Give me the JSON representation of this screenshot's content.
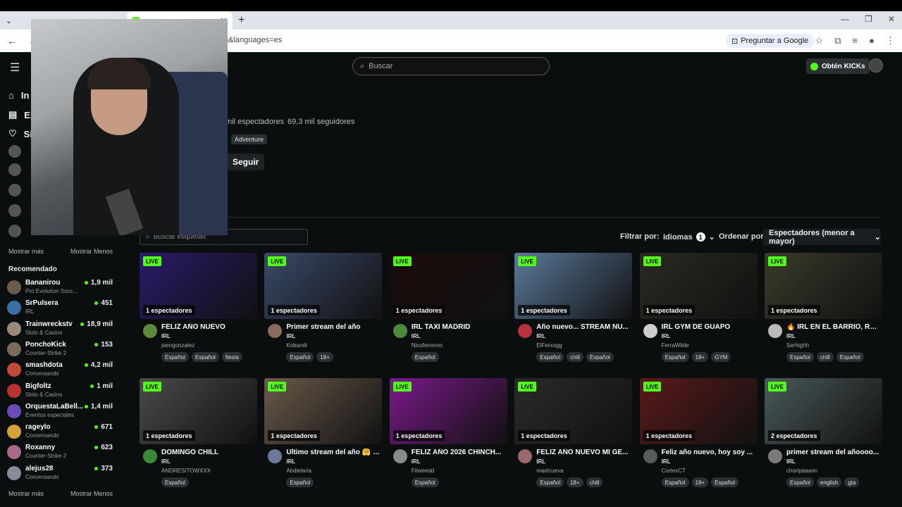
{
  "browser": {
    "url_fragment": "n&languages=es",
    "ask_google": "Preguntar a Google"
  },
  "header": {
    "search_placeholder": "Buscar",
    "kicks_label": "Obtén KICKs"
  },
  "sidebar": {
    "nav_inicio": "In",
    "nav_explorar": "Ex",
    "nav_siguiendo": "Si",
    "show_more_1": "Mostrar más",
    "show_less_1": "Mostrar Menos",
    "recommended_title": "Recomendado",
    "show_more_2": "Mostrar más",
    "show_less_2": "Mostrar Menos",
    "recommended": [
      {
        "name": "Bananirou",
        "category": "Pro Evolution Socc...",
        "viewers": "1,9 mil",
        "color": "#6b5a4a"
      },
      {
        "name": "SrPulsera",
        "category": "IRL",
        "viewers": "451",
        "color": "#3b6ea5"
      },
      {
        "name": "Trainwreckstv",
        "category": "Slots & Casino",
        "viewers": "18,9 mil",
        "color": "#9a8a7a"
      },
      {
        "name": "PonchoKick",
        "category": "Counter-Strike 2",
        "viewers": "153",
        "color": "#7a6a5a"
      },
      {
        "name": "smashdota",
        "category": "Conversando",
        "viewers": "4,2 mil",
        "color": "#c24a3a"
      },
      {
        "name": "Bigfoltz",
        "category": "Slots & Casino",
        "viewers": "1 mil",
        "color": "#b83232"
      },
      {
        "name": "OrquestaLaBell...",
        "category": "Eventos especiales",
        "viewers": "1,4 mil",
        "color": "#6a4ab8"
      },
      {
        "name": "rageylo",
        "category": "Conversando",
        "viewers": "671",
        "color": "#d4a23a"
      },
      {
        "name": "Roxanny",
        "category": "Counter-Strike 2",
        "viewers": "623",
        "color": "#a86a8a"
      },
      {
        "name": "alejus28",
        "category": "Conversando",
        "viewers": "373",
        "color": "#8a8a9a"
      }
    ]
  },
  "channel": {
    "viewers_text": "mil espectadores",
    "followers_text": "69,3 mil seguidores",
    "tag": "Adventure",
    "follow_label": "Seguir"
  },
  "filters": {
    "tag_search_placeholder": "Buscar etiquetas",
    "filter_label": "Filtrar por:",
    "languages_label": "Idiomas",
    "languages_count": "1",
    "sort_label": "Ordenar por:",
    "sort_value": "Espectadores (menor a mayor)"
  },
  "streams": [
    {
      "live": "LIVE",
      "viewers": "1 espectadores",
      "title": "FELIZ AÑO NUEVO",
      "category": "IRL",
      "user": "jaengonzalez",
      "tags": [
        "Español",
        "Español",
        "fiesta"
      ],
      "thumb_color": "#2a1a6a",
      "avatar_color": "#5a8a3a"
    },
    {
      "live": "LIVE",
      "viewers": "1 espectadores",
      "title": "Primer stream del año",
      "category": "IRL",
      "user": "Kobandi",
      "tags": [
        "Español",
        "18+"
      ],
      "thumb_color": "#3a4a6a",
      "avatar_color": "#8a6a5a"
    },
    {
      "live": "LIVE",
      "viewers": "1 espectadores",
      "title": "IRL TAXI MADRID",
      "category": "IRL",
      "user": "Nicoferreroo",
      "tags": [
        "Español"
      ],
      "thumb_color": "#1a0a0a",
      "avatar_color": "#4a8a3a"
    },
    {
      "live": "LIVE",
      "viewers": "1 espectadores",
      "title": "Año nuevo... STREAM NU...",
      "category": "IRL",
      "user": "ElFerxogg",
      "tags": [
        "Español",
        "chill",
        "Español"
      ],
      "thumb_color": "#5a7a9a",
      "avatar_color": "#b8323a"
    },
    {
      "live": "LIVE",
      "viewers": "1 espectadores",
      "title": "IRL GYM DE GUAPO",
      "category": "IRL",
      "user": "FerraWilde",
      "tags": [
        "Español",
        "18+",
        "GYM"
      ],
      "thumb_color": "#2a2a22",
      "avatar_color": "#cccccc"
    },
    {
      "live": "LIVE",
      "viewers": "1 espectadores",
      "title": "🔥 IRL EN EL BARRIO, REC...",
      "category": "IRL",
      "user": "Serhighh",
      "tags": [
        "Español",
        "chill",
        "Español"
      ],
      "thumb_color": "#3a3a2a",
      "avatar_color": "#bbbbbb"
    },
    {
      "live": "LIVE",
      "viewers": "1 espectadores",
      "title": "DOMINGO CHILL",
      "category": "IRL",
      "user": "ANDRESITOWXXX",
      "tags": [
        "Español"
      ],
      "thumb_color": "#4a4a4a",
      "avatar_color": "#3a8a3a"
    },
    {
      "live": "LIVE",
      "viewers": "1 espectadores",
      "title": "Último stream del año 🤗 🤗",
      "category": "IRL",
      "user": "Abdielaria",
      "tags": [
        "Español"
      ],
      "thumb_color": "#6a5a4a",
      "avatar_color": "#6a7a9a"
    },
    {
      "live": "LIVE",
      "viewers": "1 espectadores",
      "title": "FELIZ AÑO 2026 CHINCH...",
      "category": "IRL",
      "user": "Fitweedd",
      "tags": [
        "Español"
      ],
      "thumb_color": "#7a1a8a",
      "avatar_color": "#8a8a8a"
    },
    {
      "live": "LIVE",
      "viewers": "1 espectadores",
      "title": "FELIZ AÑO NUEVO MI GE...",
      "category": "IRL",
      "user": "maxlcueva",
      "tags": [
        "Español",
        "18+",
        "chill"
      ],
      "thumb_color": "#2a2a2a",
      "avatar_color": "#9a6a6a"
    },
    {
      "live": "LIVE",
      "viewers": "1 espectadores",
      "title": "Feliz año nuevo, hoy soy ...",
      "category": "IRL",
      "user": "CortexCT",
      "tags": [
        "Español",
        "18+",
        "Español"
      ],
      "thumb_color": "#5a1a1a",
      "avatar_color": "#5a5a5a"
    },
    {
      "live": "LIVE",
      "viewers": "2 espectadores",
      "title": "primer stream del añoooo...",
      "category": "IRL",
      "user": "choripaaann",
      "tags": [
        "Español",
        "english",
        "gta"
      ],
      "thumb_color": "#4a5a5a",
      "avatar_color": "#7a7a7a"
    }
  ]
}
